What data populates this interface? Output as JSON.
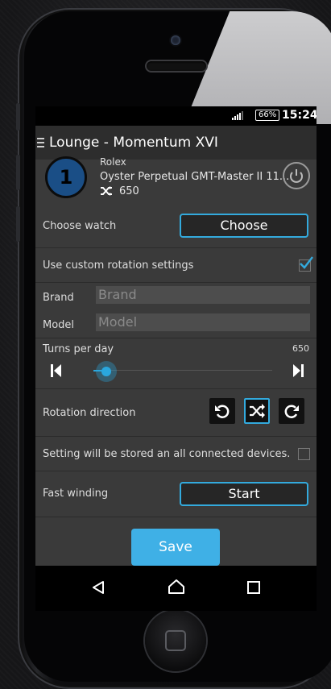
{
  "status_bar": {
    "battery": "66%",
    "time": "15:24"
  },
  "app_bar": {
    "title": "Lounge - Momentum XVI"
  },
  "watch": {
    "number": "1",
    "brand": "Rolex",
    "model": "Oyster Perpetual GMT-Master II 11...",
    "turns": "650"
  },
  "choose_watch": {
    "label": "Choose watch",
    "button": "Choose"
  },
  "custom_rotation": {
    "label": "Use custom rotation settings",
    "checked": true
  },
  "brand_field": {
    "label": "Brand",
    "placeholder": "Brand"
  },
  "model_field": {
    "label": "Model",
    "placeholder": "Model"
  },
  "turns_per_day": {
    "label": "Turns per day",
    "value": "650",
    "slider_fraction": 0.07
  },
  "rotation_direction": {
    "label": "Rotation direction",
    "options": [
      "counterclockwise-icon",
      "shuffle-icon",
      "clockwise-icon"
    ],
    "selected": "shuffle-icon"
  },
  "store_setting": {
    "label": "Setting will be stored an all connected devices.",
    "checked": false
  },
  "fast_winding": {
    "label": "Fast winding",
    "button": "Start"
  },
  "save": {
    "label": "Save"
  },
  "colors": {
    "accent": "#33aadd",
    "save": "#3fb0e6",
    "badge": "#1a4e86"
  }
}
